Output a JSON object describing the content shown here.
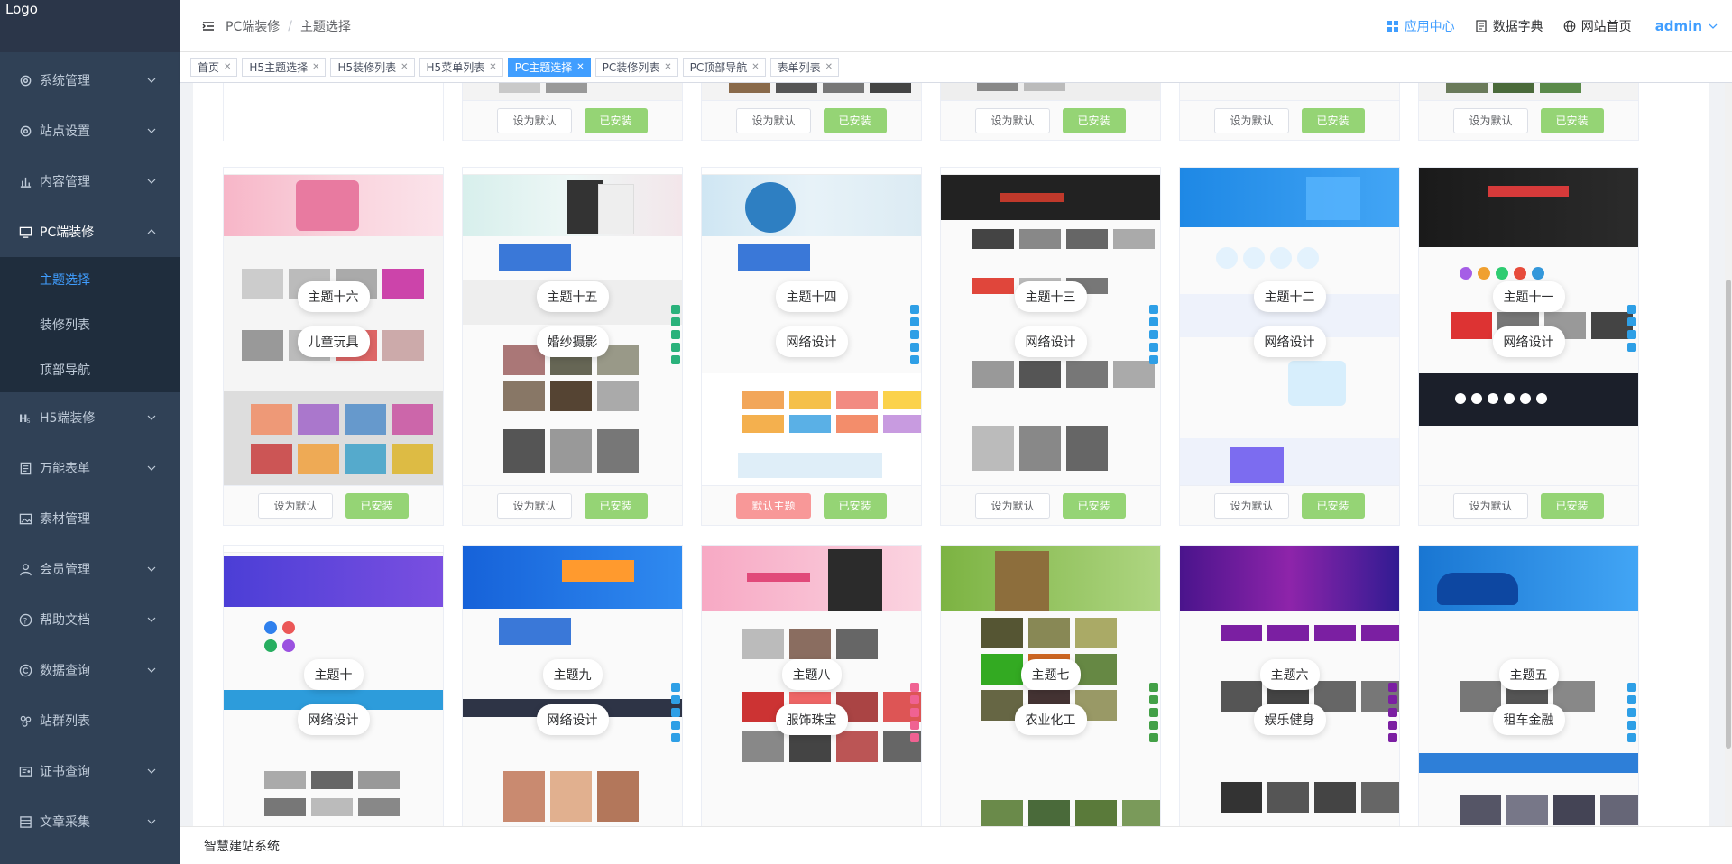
{
  "logo": {
    "alt": "Logo"
  },
  "sidebar": {
    "items": [
      {
        "label": "系统管理",
        "icon": "gear-icon"
      },
      {
        "label": "站点设置",
        "icon": "gear-icon"
      },
      {
        "label": "内容管理",
        "icon": "bar-chart-icon"
      },
      {
        "label": "PC端装修",
        "icon": "monitor-icon",
        "open": true
      },
      {
        "label": "H5端装修",
        "icon": "h5-icon"
      },
      {
        "label": "万能表单",
        "icon": "form-icon"
      },
      {
        "label": "素材管理",
        "icon": "image-icon"
      },
      {
        "label": "会员管理",
        "icon": "user-icon"
      },
      {
        "label": "帮助文档",
        "icon": "question-icon"
      },
      {
        "label": "数据查询",
        "icon": "copyright-icon"
      },
      {
        "label": "站群列表",
        "icon": "cluster-icon"
      },
      {
        "label": "证书查询",
        "icon": "certificate-icon"
      },
      {
        "label": "文章采集",
        "icon": "collect-icon"
      }
    ],
    "pc_sub": [
      {
        "label": "主题选择",
        "active": true
      },
      {
        "label": "装修列表"
      },
      {
        "label": "顶部导航"
      }
    ]
  },
  "header": {
    "breadcrumb": [
      "PC端装修",
      "主题选择"
    ],
    "app_center": "应用中心",
    "data_dict": "数据字典",
    "site_home": "网站首页",
    "user": "admin"
  },
  "tags": [
    {
      "label": "首页"
    },
    {
      "label": "H5主题选择"
    },
    {
      "label": "H5装修列表"
    },
    {
      "label": "H5菜单列表"
    },
    {
      "label": "PC主题选择",
      "active": true
    },
    {
      "label": "PC装修列表"
    },
    {
      "label": "PC顶部导航"
    },
    {
      "label": "表单列表"
    }
  ],
  "buttons": {
    "set_default": "设为默认",
    "installed": "已安装",
    "default_theme": "默认主题"
  },
  "themes_row2": [
    {
      "name": "主题十六",
      "category": "儿童玩具"
    },
    {
      "name": "主题十五",
      "category": "婚纱摄影"
    },
    {
      "name": "主题十四",
      "category": "网络设计",
      "is_default": true
    },
    {
      "name": "主题十三",
      "category": "网络设计"
    },
    {
      "name": "主题十二",
      "category": "网络设计"
    },
    {
      "name": "主题十一",
      "category": "网络设计"
    }
  ],
  "themes_row3": [
    {
      "name": "主题十",
      "category": "网络设计"
    },
    {
      "name": "主题九",
      "category": "网络设计"
    },
    {
      "name": "主题八",
      "category": "服饰珠宝"
    },
    {
      "name": "主题七",
      "category": "农业化工"
    },
    {
      "name": "主题六",
      "category": "娱乐健身"
    },
    {
      "name": "主题五",
      "category": "租车金融"
    }
  ],
  "footer": {
    "text": "智慧建站系统"
  },
  "colors": {
    "sidebar_bg": "#304156",
    "accent": "#409eff",
    "success_light": "#95d475",
    "danger_light": "#f89898"
  }
}
